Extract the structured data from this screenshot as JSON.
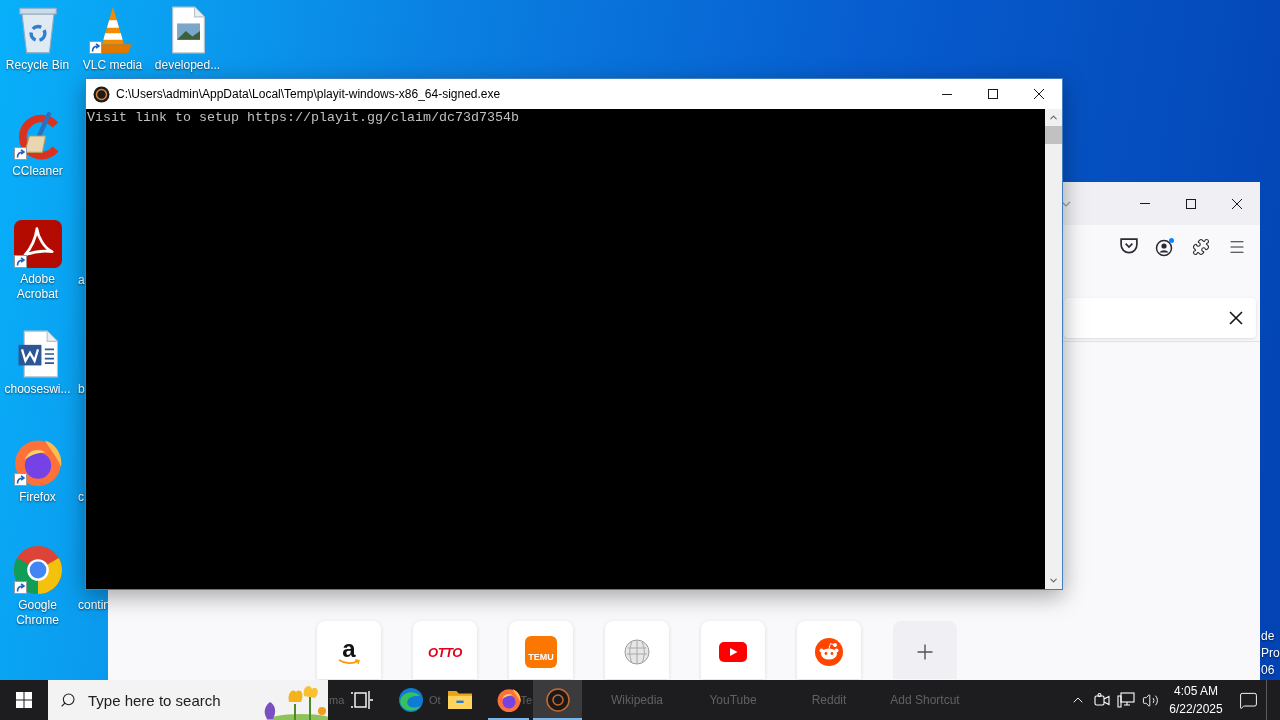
{
  "desktop": {
    "icons": [
      {
        "label": "Recycle Bin",
        "kind": "recycle_bin",
        "shortcut": false
      },
      {
        "label": "VLC media",
        "kind": "vlc",
        "shortcut": true
      },
      {
        "label": "developed...",
        "kind": "image_file",
        "shortcut": false
      },
      {
        "label": "CCleaner",
        "kind": "ccleaner",
        "shortcut": true
      },
      {
        "label": "Adobe Acrobat",
        "kind": "acrobat",
        "shortcut": true
      },
      {
        "label": "chooseswi...",
        "kind": "word_document",
        "shortcut": false
      },
      {
        "label": "Firefox",
        "kind": "firefox",
        "shortcut": true
      },
      {
        "label": "Google Chrome",
        "kind": "chrome",
        "shortcut": true
      }
    ],
    "covered_labels": [
      "a",
      "b",
      "c",
      "contin"
    ],
    "edge_text": [
      "de",
      "Pro",
      "06"
    ]
  },
  "console_window": {
    "title": "C:\\Users\\admin\\AppData\\Local\\Temp\\playit-windows-x86_64-signed.exe",
    "lines": [
      "Visit link to setup https://playit.gg/claim/dc73d7354b"
    ]
  },
  "browser_window": {
    "shortcuts": [
      {
        "kind": "amazon",
        "logo": "a",
        "label": "ma"
      },
      {
        "kind": "otto",
        "logo": "OTTO",
        "label": "Ot"
      },
      {
        "kind": "temu",
        "logo": "TEMU",
        "label": "Te"
      },
      {
        "kind": "wikipedia",
        "label": "Wikipedia"
      },
      {
        "kind": "youtube",
        "label": "YouTube"
      },
      {
        "kind": "reddit",
        "label": "Reddit"
      },
      {
        "kind": "add",
        "label": "Add Shortcut"
      }
    ]
  },
  "taskbar": {
    "search": {
      "placeholder": "Type here to search"
    },
    "apps": [
      {
        "kind": "task_view",
        "running": false,
        "selected": false
      },
      {
        "kind": "edge",
        "running": false,
        "selected": false
      },
      {
        "kind": "explorer",
        "running": false,
        "selected": false
      },
      {
        "kind": "firefox",
        "running": true,
        "selected": false
      },
      {
        "kind": "playit",
        "running": true,
        "selected": true
      }
    ],
    "clock": {
      "time": "4:05 AM",
      "date": "6/22/2025"
    }
  }
}
